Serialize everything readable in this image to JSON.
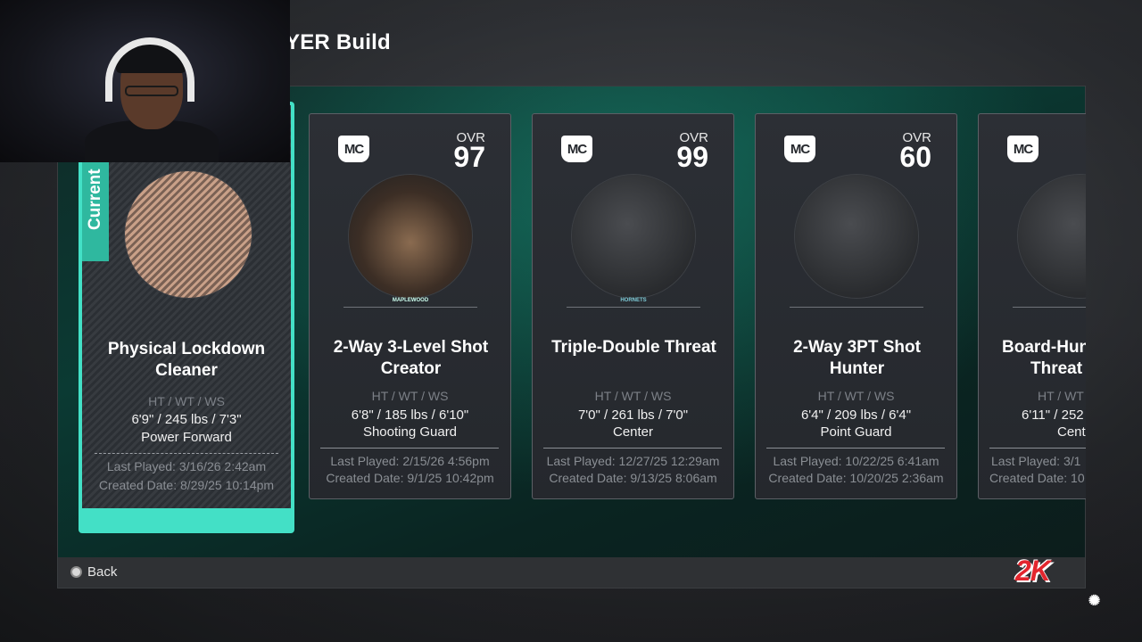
{
  "header": {
    "title": "YER Build"
  },
  "current": {
    "tab_label": "Current",
    "name": "Physical Lockdown Cleaner",
    "stat_header": "HT / WT / WS",
    "stats": "6'9\" / 245 lbs / 7'3\"",
    "position": "Power Forward",
    "last_played": "Last Played: 3/16/26 2:42am",
    "created": "Created Date: 8/29/25 10:14pm"
  },
  "cards": [
    {
      "badge": "MC",
      "ovr_label": "OVR",
      "ovr": "97",
      "team": "MAPLEWOOD",
      "name_line1": "2-Way 3-Level Shot",
      "name_line2": "Creator",
      "stat_header": "HT / WT / WS",
      "stats": "6'8\" / 185 lbs / 6'10\"",
      "position": "Shooting Guard",
      "last_played": "Last Played: 2/15/26 4:56pm",
      "created": "Created Date: 9/1/25 10:42pm"
    },
    {
      "badge": "MC",
      "ovr_label": "OVR",
      "ovr": "99",
      "team": "HORNETS",
      "name_line1": "Triple-Double Threat",
      "name_line2": "",
      "stat_header": "HT / WT / WS",
      "stats": "7'0\" / 261 lbs / 7'0\"",
      "position": "Center",
      "last_played": "Last Played: 12/27/25 12:29am",
      "created": "Created Date: 9/13/25 8:06am"
    },
    {
      "badge": "MC",
      "ovr_label": "OVR",
      "ovr": "60",
      "team": "",
      "name_line1": "2-Way 3PT Shot",
      "name_line2": "Hunter",
      "stat_header": "HT / WT / WS",
      "stats": "6'4\" / 209 lbs / 6'4\"",
      "position": "Point Guard",
      "last_played": "Last Played: 10/22/25 6:41am",
      "created": "Created Date: 10/20/25 2:36am"
    },
    {
      "badge": "MC",
      "ovr_label": "",
      "ovr": "",
      "team": "",
      "name_line1": "Board-Hun",
      "name_line2": "Threat",
      "stat_header": "HT / WT",
      "stats": "6'11\" / 252",
      "position": "Cent",
      "last_played": "Last Played: 3/1",
      "created": "Created Date: 10"
    }
  ],
  "footer": {
    "back_label": "Back",
    "brand": "2K"
  },
  "colors": {
    "accent": "#43e0c6",
    "brand_red": "#e3262e"
  }
}
